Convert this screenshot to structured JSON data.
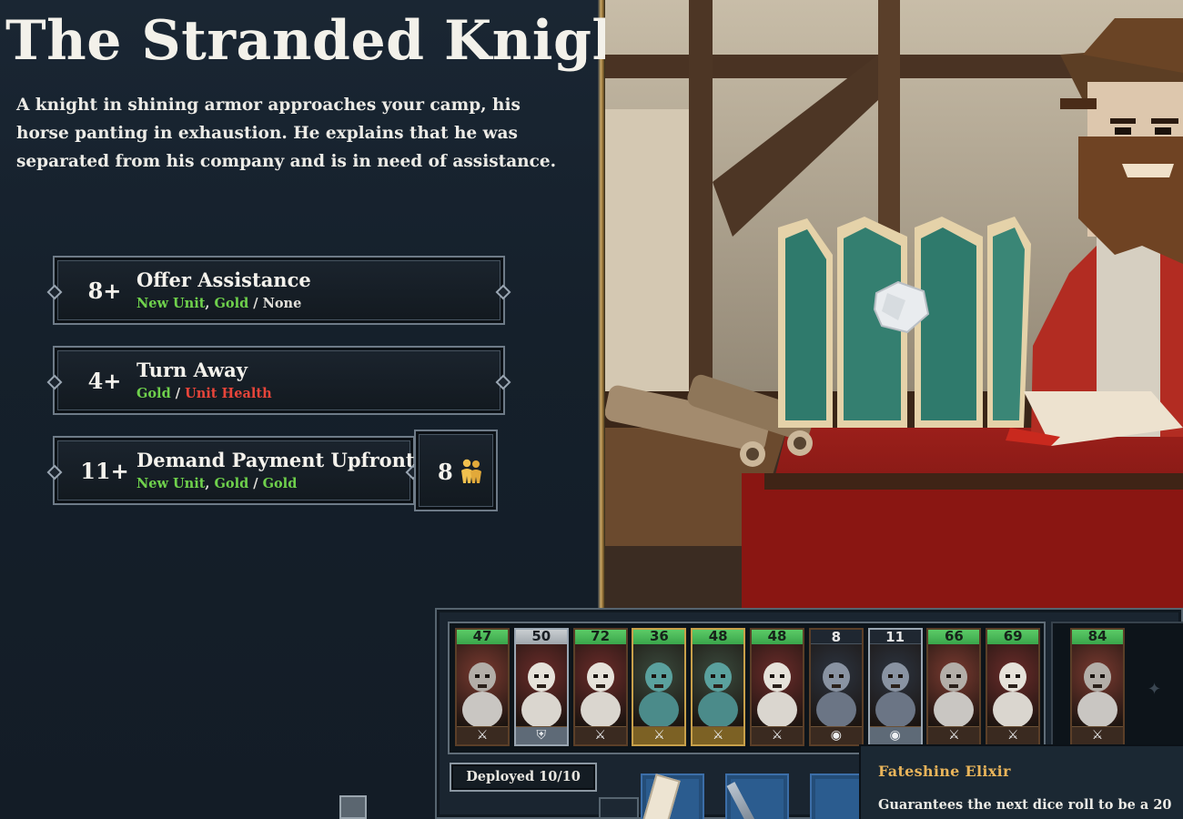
{
  "event": {
    "title": "The Stranded Knight",
    "description": "A knight in shining armor approaches your camp, his horse panting in exhaustion. He explains that he was separated from his company and is in need of assistance."
  },
  "choices": [
    {
      "roll": "8+",
      "label": "Offer Assistance",
      "outcomes": [
        {
          "text": "New Unit",
          "tone": "good"
        },
        {
          "text": ", ",
          "tone": "neutral"
        },
        {
          "text": "Gold",
          "tone": "good"
        },
        {
          "text": " / ",
          "tone": "neutral"
        },
        {
          "text": "None",
          "tone": "neutral"
        }
      ]
    },
    {
      "roll": "4+",
      "label": "Turn Away",
      "outcomes": [
        {
          "text": "Gold",
          "tone": "good"
        },
        {
          "text": " / ",
          "tone": "neutral"
        },
        {
          "text": "Unit Health",
          "tone": "bad"
        }
      ]
    },
    {
      "roll": "11+",
      "label": "Demand Payment Upfront",
      "outcomes": [
        {
          "text": "New Unit",
          "tone": "good"
        },
        {
          "text": ", ",
          "tone": "neutral"
        },
        {
          "text": "Gold",
          "tone": "good"
        },
        {
          "text": " / ",
          "tone": "neutral"
        },
        {
          "text": "Gold",
          "tone": "good"
        }
      ],
      "cost": "8",
      "cost_icon": "units-icon"
    }
  ],
  "roster": {
    "units": [
      {
        "hp": "47",
        "badge": "sword-icon",
        "tier": "bronze",
        "creature": "boar"
      },
      {
        "hp": "50",
        "badge": "shield-icon",
        "tier": "silver",
        "creature": "skeleton"
      },
      {
        "hp": "72",
        "badge": "sword-icon",
        "tier": "bronze",
        "creature": "skeleton"
      },
      {
        "hp": "36",
        "badge": "sword-icon",
        "tier": "gold",
        "creature": "ghoul"
      },
      {
        "hp": "48",
        "badge": "sword-icon",
        "tier": "gold",
        "creature": "ghoul"
      },
      {
        "hp": "48",
        "badge": "sword-icon",
        "tier": "bronze",
        "creature": "skeleton"
      },
      {
        "hp": "8",
        "badge": "wolf-icon",
        "tier": "bronze",
        "creature": "wolf"
      },
      {
        "hp": "11",
        "badge": "wolf-icon",
        "tier": "silver",
        "creature": "wolf"
      },
      {
        "hp": "66",
        "badge": "sword-icon",
        "tier": "bronze",
        "creature": "boar"
      },
      {
        "hp": "69",
        "badge": "sword-icon",
        "tier": "bronze",
        "creature": "skeleton"
      }
    ],
    "reserve": [
      {
        "hp": "84",
        "badge": "sword-icon",
        "tier": "bronze",
        "creature": "boar"
      }
    ],
    "deployed_label": "Deployed 10/10"
  },
  "tooltip": {
    "title": "Fateshine Elixir",
    "description": "Guarantees the next dice roll to be a 20"
  }
}
